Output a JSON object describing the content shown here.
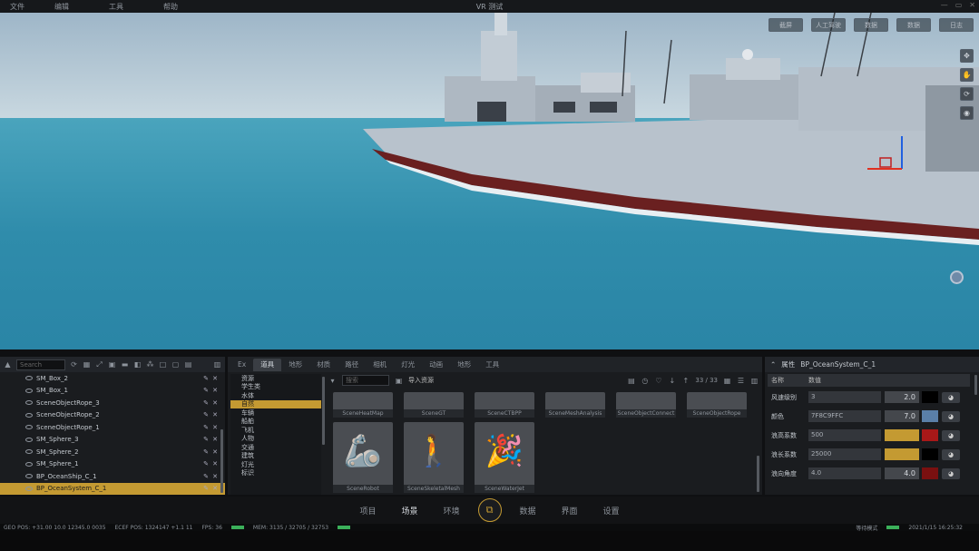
{
  "window": {
    "title": "VR 测试",
    "menu": [
      "文件",
      "编辑",
      "工具",
      "帮助"
    ]
  },
  "viewport": {
    "toolbar": [
      "截屏",
      "人工驾驶",
      "数据",
      "数据",
      "日志"
    ]
  },
  "outliner": {
    "search_placeholder": "Search",
    "items": [
      "SM_Box_2",
      "SM_Box_1",
      "SceneObjectRope_3",
      "SceneObjectRope_2",
      "SceneObjectRope_1",
      "SM_Sphere_3",
      "SM_Sphere_2",
      "SM_Sphere_1",
      "BP_OceanShip_C_1",
      "BP_OceanSystem_C_1"
    ],
    "selected_index": 9
  },
  "content": {
    "tabs": [
      "Ex",
      "道具",
      "地形",
      "材质",
      "路径",
      "相机",
      "灯光",
      "动画",
      "地形",
      "工具"
    ],
    "active_tab": 1,
    "categories": [
      "资源",
      "学生类",
      "水体",
      "自然",
      "车辆",
      "船舶",
      "飞机",
      "人物",
      "交通",
      "建筑",
      "灯光",
      "标识"
    ],
    "selected_category": 3,
    "search_placeholder": "搜索",
    "import_label": "导入资源",
    "page_count": "33 / 33",
    "assets_row1": [
      "SceneHeatMap",
      "SceneGT",
      "SceneCTBPP",
      "SceneMeshAnalysis",
      "SceneObjectConnect",
      "SceneObjectRope"
    ],
    "assets_row2": [
      "SceneRobot",
      "SceneSkeletalMesh",
      "SceneWaterJet"
    ]
  },
  "properties": {
    "header": "属性",
    "object": "BP_OceanSystem_C_1",
    "col_name": "名称",
    "col_value": "数值",
    "rows": [
      {
        "name": "风速级别",
        "value": "3",
        "num": "2.0",
        "color": "#000000"
      },
      {
        "name": "颜色",
        "value": "7F8C9FFC",
        "num": "7.0",
        "color": "#5a7fa8"
      },
      {
        "name": "浪高系数",
        "value": "500",
        "num": "",
        "color": "#a81818"
      },
      {
        "name": "浪长系数",
        "value": "25000",
        "num": "",
        "color": "#000000"
      },
      {
        "name": "浪向角度",
        "value": "4.0",
        "num": "4.0",
        "color": "#7a1010"
      }
    ]
  },
  "navbar": {
    "items": [
      "项目",
      "场景",
      "环境",
      "数据",
      "界面",
      "设置"
    ],
    "active_index": 1
  },
  "statusbar": {
    "left": "GEO POS: +31.00 10.0 12345.0 0035",
    "mid1": "ECEF POS: 1324147 +1.1 11",
    "mid2": "FPS: 36",
    "mid3": "MEM: 3135 / 32705 / 32753",
    "right1": "等待模式",
    "right2": "2021/1/15 16:25:32"
  }
}
